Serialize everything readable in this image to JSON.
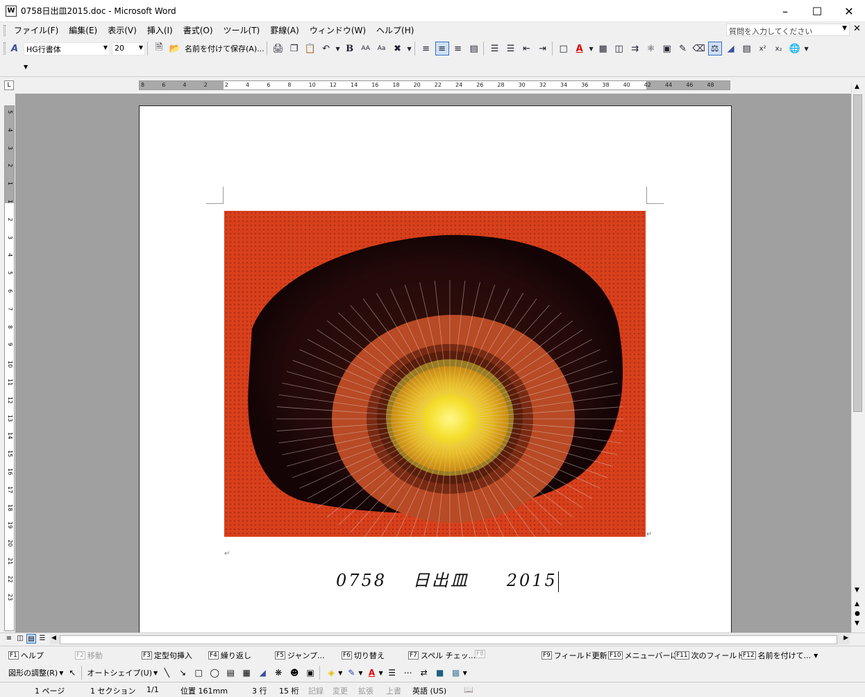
{
  "window": {
    "title": "0758日出皿2015.doc - Microsoft Word"
  },
  "menu": [
    "ファイル(F)",
    "編集(E)",
    "表示(V)",
    "挿入(I)",
    "書式(O)",
    "ツール(T)",
    "罫線(A)",
    "ウィンドウ(W)",
    "ヘルプ(H)"
  ],
  "help_box": {
    "placeholder": "質問を入力してください"
  },
  "toolbar": {
    "font_name": "HG行書体",
    "font_size": "20",
    "save_as_label": "名前を付けて保存(A)...",
    "bold_label": "B"
  },
  "ruler": {
    "h_ticks": [
      "8",
      "6",
      "4",
      "2",
      "2",
      "4",
      "6",
      "8",
      "10",
      "12",
      "14",
      "16",
      "18",
      "20",
      "22",
      "24",
      "26",
      "28",
      "30",
      "32",
      "34",
      "36",
      "38",
      "40",
      "42",
      "44",
      "46",
      "48"
    ],
    "v_ticks": [
      "5",
      "4",
      "3",
      "2",
      "1",
      "1",
      "2",
      "3",
      "4",
      "5",
      "6",
      "7",
      "8",
      "9",
      "10",
      "11",
      "12",
      "13",
      "14",
      "15",
      "16",
      "17",
      "18",
      "19",
      "20",
      "21",
      "22",
      "23"
    ]
  },
  "document": {
    "caption": "0758　 日出皿　　2015",
    "image_alt": "赤い布の上に置かれた日の出模様の陶器皿"
  },
  "fkeys": [
    {
      "key": "F1",
      "label": "ヘルプ",
      "enabled": true
    },
    {
      "key": "F2",
      "label": "移動",
      "enabled": false
    },
    {
      "key": "F3",
      "label": "定型句挿入",
      "enabled": true
    },
    {
      "key": "F4",
      "label": "繰り返し",
      "enabled": true
    },
    {
      "key": "F5",
      "label": "ジャンプ...",
      "enabled": true
    },
    {
      "key": "F6",
      "label": "切り替え",
      "enabled": true
    },
    {
      "key": "F7",
      "label": "スペル チェッ...",
      "enabled": true
    },
    {
      "key": "F8",
      "label": "",
      "enabled": false
    },
    {
      "key": "F9",
      "label": "フィールド更新",
      "enabled": true
    },
    {
      "key": "F10",
      "label": "メニューバーに移",
      "enabled": true
    },
    {
      "key": "F11",
      "label": "次のフィールド",
      "enabled": true
    },
    {
      "key": "F12",
      "label": "名前を付けて...",
      "enabled": true
    }
  ],
  "drawing": {
    "draw_menu": "図形の調整(R)",
    "autoshape": "オートシェイプ(U)"
  },
  "status": {
    "page": "1 ページ",
    "section": "1 セクション",
    "pages": "1/1",
    "position": "位置  161mm",
    "line": "3 行",
    "column": "15 桁",
    "rec": "記録",
    "trk": "変更",
    "ext": "拡張",
    "ovr": "上書",
    "language": "英語 (US)"
  },
  "colors": {
    "accent": "#3a6fc0",
    "workspace": "#a0a0a0",
    "font_color": "#e00000"
  }
}
